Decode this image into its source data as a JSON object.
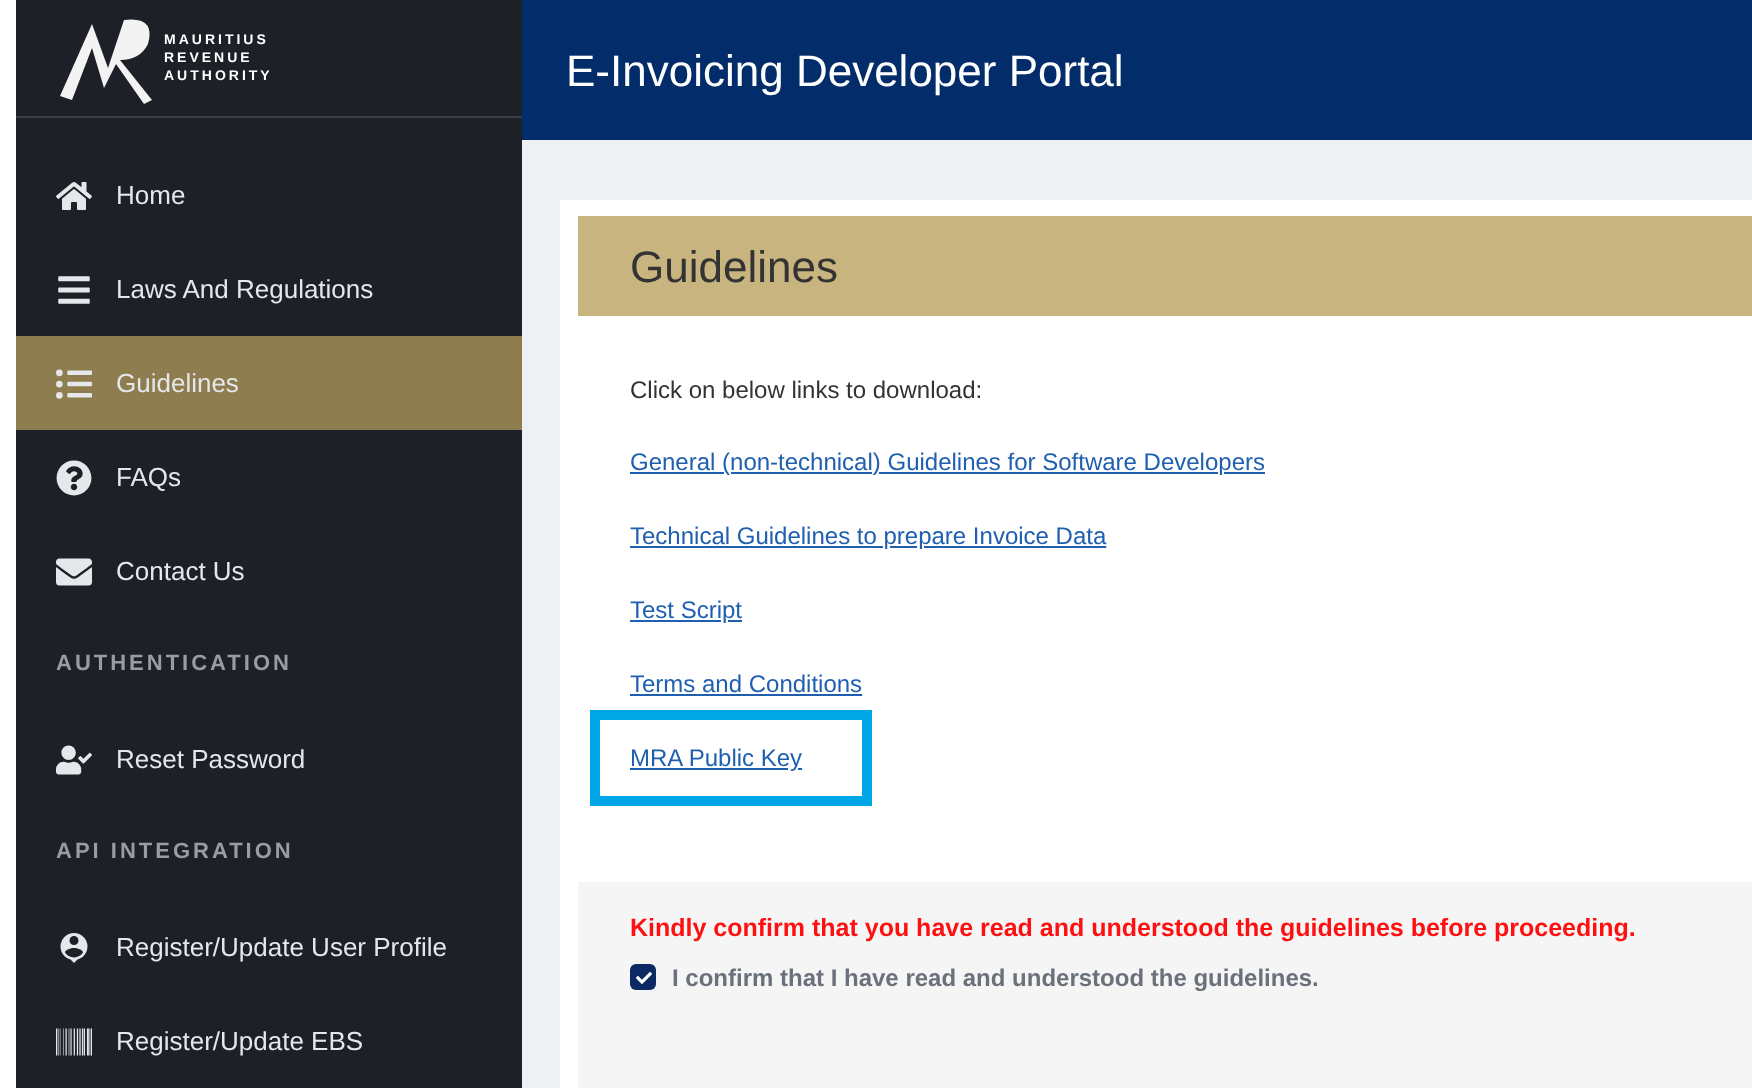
{
  "logo": {
    "lines": [
      "MAURITIUS",
      "REVENUE",
      "AUTHORITY"
    ]
  },
  "header": {
    "title": "E-Invoicing Developer Portal"
  },
  "sidebar": {
    "items": [
      {
        "kind": "link",
        "label": "Home",
        "selected": false
      },
      {
        "kind": "link",
        "label": "Laws And Regulations",
        "selected": false
      },
      {
        "kind": "link",
        "label": "Guidelines",
        "selected": true
      },
      {
        "kind": "link",
        "label": "FAQs",
        "selected": false
      },
      {
        "kind": "link",
        "label": "Contact Us",
        "selected": false
      },
      {
        "kind": "section",
        "label": "AUTHENTICATION"
      },
      {
        "kind": "link",
        "label": "Reset Password",
        "selected": false
      },
      {
        "kind": "section",
        "label": "API INTEGRATION"
      },
      {
        "kind": "link",
        "label": "Register/Update User Profile",
        "selected": false
      },
      {
        "kind": "link",
        "label": "Register/Update EBS",
        "selected": false
      }
    ]
  },
  "content": {
    "title": "Guidelines",
    "intro": "Click on below links to download:",
    "links": [
      {
        "label": "General (non-technical) Guidelines for Software Developers",
        "highlighted": false
      },
      {
        "label": "Technical Guidelines to prepare Invoice Data",
        "highlighted": false
      },
      {
        "label": "Test Script",
        "highlighted": false
      },
      {
        "label": "Terms and Conditions",
        "highlighted": false
      },
      {
        "label": "MRA Public Key",
        "highlighted": true
      }
    ],
    "confirm": {
      "warning": "Kindly confirm that you have read and understood the guidelines before proceeding.",
      "label": "I confirm that I have read and understood the guidelines.",
      "checked": true
    }
  }
}
